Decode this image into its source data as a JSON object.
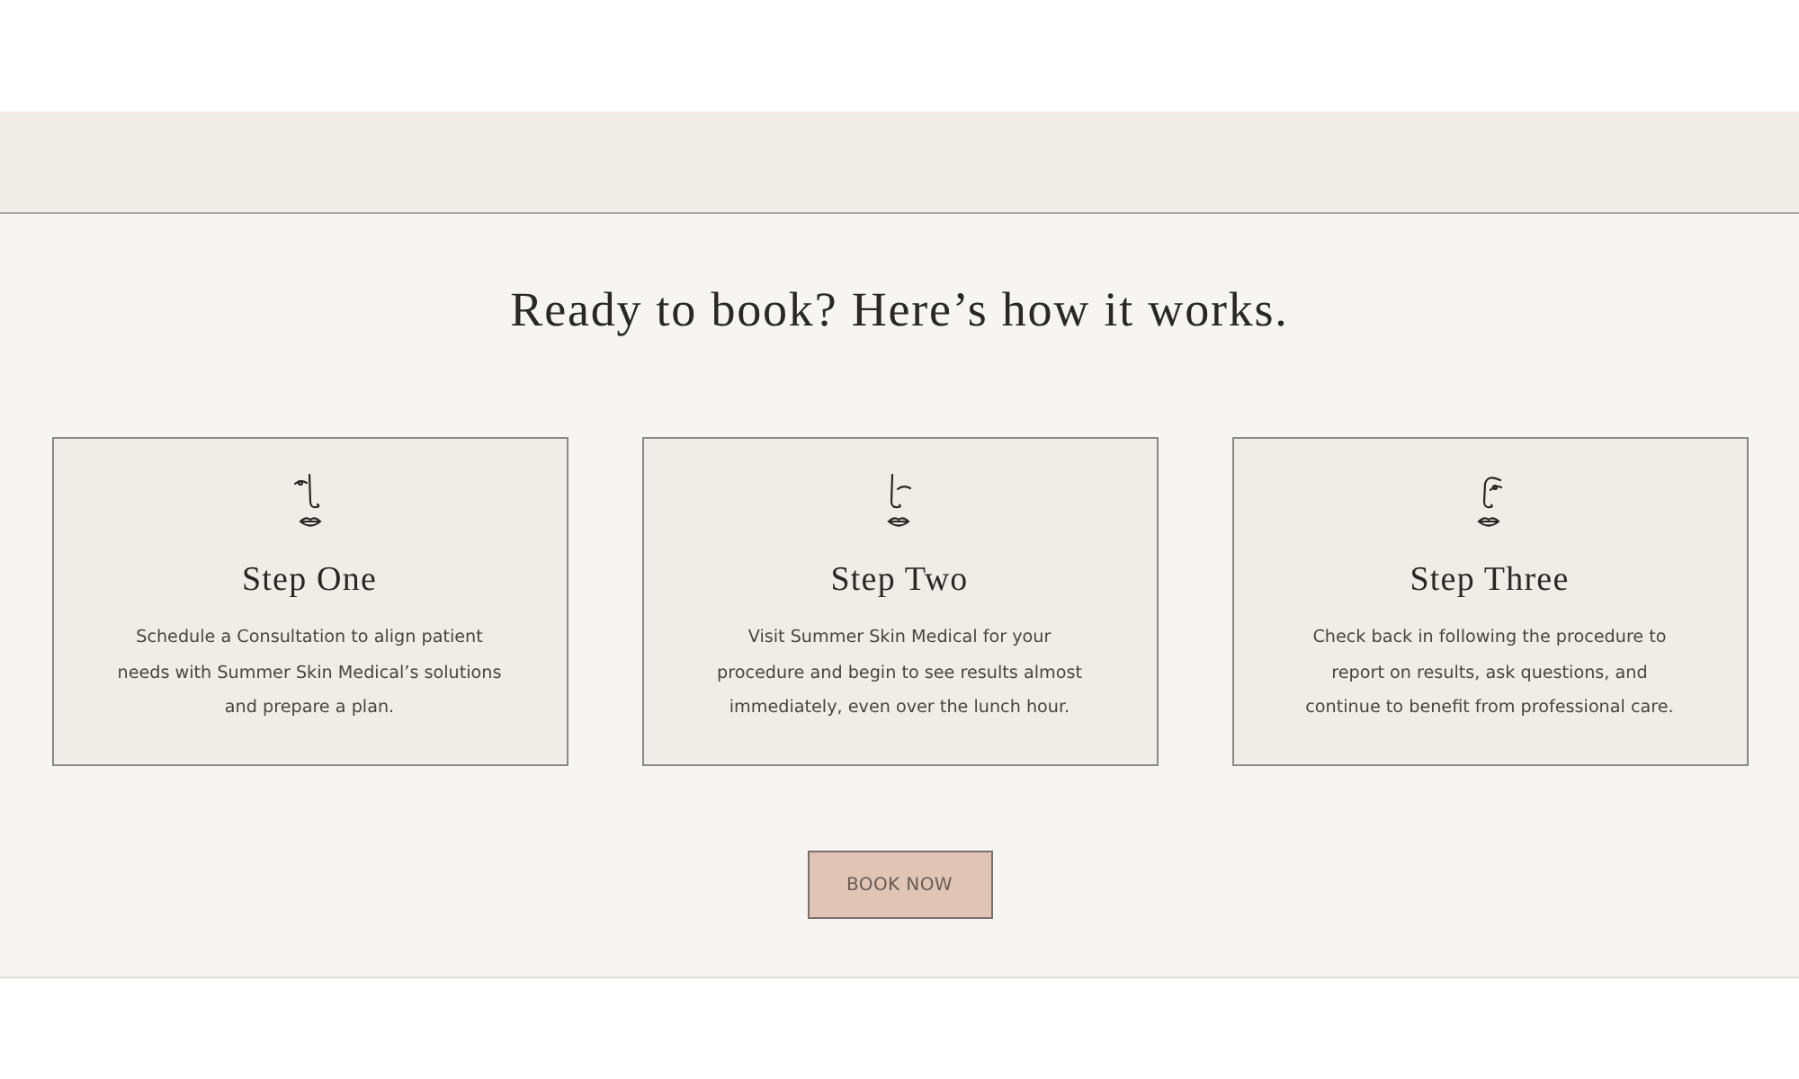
{
  "heading": "Ready to book? Here’s how it works.",
  "steps": [
    {
      "title": "Step One",
      "text": "Schedule a Consultation to align patient needs with Summer Skin Medical’s solutions and prepare a plan."
    },
    {
      "title": "Step Two",
      "text": "Visit Summer Skin Medical for your procedure and begin to see results almost immediately, even over the lunch hour."
    },
    {
      "title": "Step Three",
      "text": "Check back in following the procedure to report on results, ask questions, and continue to benefit from professional care."
    }
  ],
  "button": "BOOK NOW"
}
